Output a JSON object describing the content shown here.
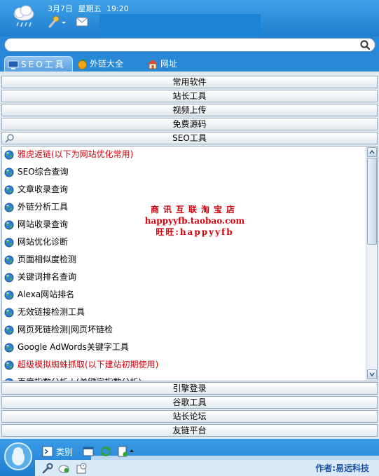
{
  "header": {
    "date": "3月7日",
    "weekday": "星期五",
    "time": "19:20"
  },
  "search": {
    "value": "",
    "placeholder": ""
  },
  "tabs": [
    {
      "label": "SEO工具",
      "icon": "monitor-icon",
      "active": true
    },
    {
      "label": "外链大全",
      "icon": "orange-fruit-icon",
      "active": false
    },
    {
      "label": "网址",
      "icon": "home-icon",
      "active": false
    }
  ],
  "categories_top": [
    "常用软件",
    "站长工具",
    "视频上传",
    "免费源码",
    "SEO工具"
  ],
  "list_items": [
    {
      "label": "雅虎返链(以下为网站优化常用)",
      "red": true
    },
    {
      "label": "SEO综合查询",
      "red": false
    },
    {
      "label": "文章收录查询",
      "red": false
    },
    {
      "label": "外链分析工具",
      "red": false
    },
    {
      "label": "网站收录查询",
      "red": false
    },
    {
      "label": "网站优化诊断",
      "red": false
    },
    {
      "label": "页面相似度检测",
      "red": false
    },
    {
      "label": "关键词排名查询",
      "red": false
    },
    {
      "label": "Alexa网站排名",
      "red": false
    },
    {
      "label": "无效链接检测工具",
      "red": false
    },
    {
      "label": "网页死链检测|网页坏链检",
      "red": false
    },
    {
      "label": "Google AdWords关键字工具",
      "red": false
    },
    {
      "label": "超级模拟蜘蛛抓取(以下建站初期使用)",
      "red": true
    },
    {
      "label": "百度指数分析 | (关键字指数分析)",
      "red": false
    }
  ],
  "ad": {
    "line1": "商讯互联淘宝店",
    "line2": "happyyfb.taobao.com",
    "line3": "旺旺:happyyfb"
  },
  "categories_bottom": [
    "引擎登录",
    "谷歌工具",
    "站长论坛",
    "友链平台"
  ],
  "footer": {
    "category_label": "类别",
    "author": "作者:易远科技"
  },
  "colors": {
    "accent": "#1f7fd0",
    "link_red": "#d4000b",
    "author_blue": "#1b52a6"
  }
}
